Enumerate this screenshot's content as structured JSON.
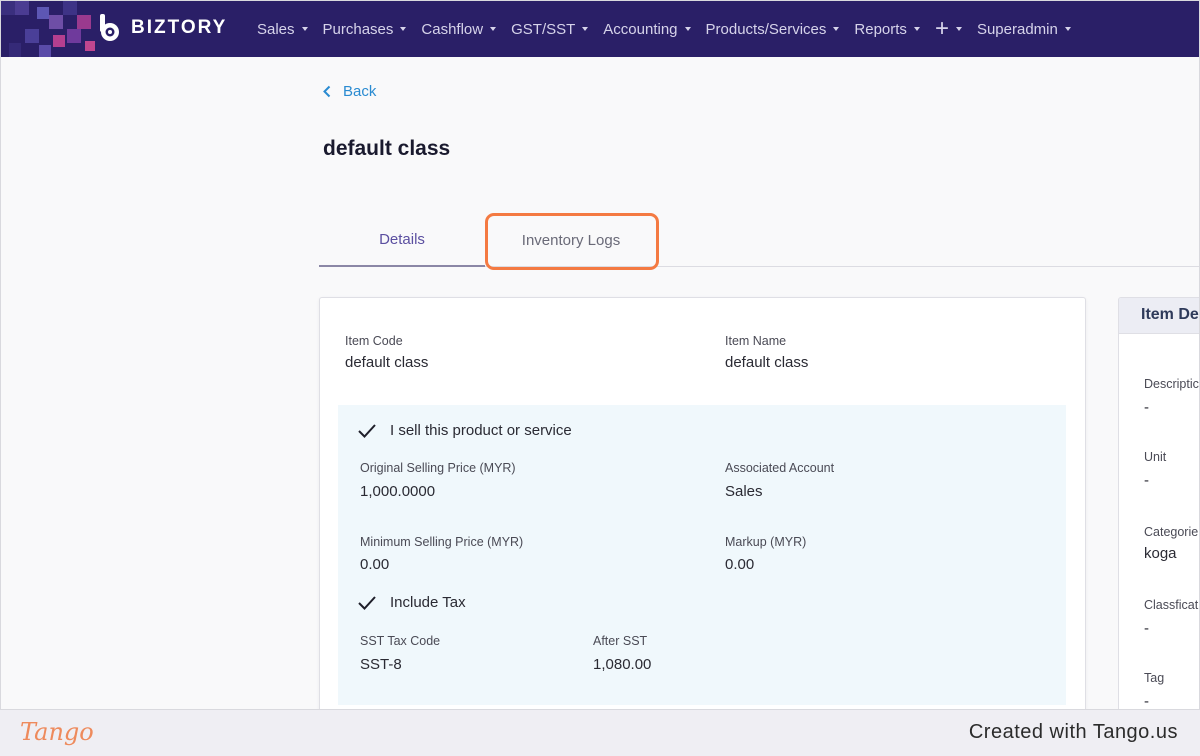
{
  "brand": {
    "name": "BIZTORY",
    "nav_bg": "#2a1f67"
  },
  "nav": {
    "items": [
      {
        "label": "Sales",
        "name": "nav-sales"
      },
      {
        "label": "Purchases",
        "name": "nav-purchases"
      },
      {
        "label": "Cashflow",
        "name": "nav-cashflow"
      },
      {
        "label": "GST/SST",
        "name": "nav-gst-sst"
      },
      {
        "label": "Accounting",
        "name": "nav-accounting"
      },
      {
        "label": "Products/Services",
        "name": "nav-products-services"
      },
      {
        "label": "Reports",
        "name": "nav-reports"
      }
    ],
    "plus_icon": "+",
    "user_label": "Superadmin"
  },
  "back": {
    "label": "Back"
  },
  "page": {
    "title": "default class"
  },
  "tabs": [
    {
      "label": "Details",
      "active": true
    },
    {
      "label": "Inventory Logs",
      "active": false
    }
  ],
  "details": {
    "item_code_label": "Item Code",
    "item_code": "default class",
    "item_name_label": "Item Name",
    "item_name": "default class",
    "sell_label": "I sell this product or service",
    "original_price_label": "Original Selling Price (MYR)",
    "original_price": "1,000.0000",
    "associated_account_label": "Associated Account",
    "associated_account": "Sales",
    "minimum_price_label": "Minimum Selling Price (MYR)",
    "minimum_price": "0.00",
    "markup_label": "Markup (MYR)",
    "markup": "0.00",
    "include_tax_label": "Include Tax",
    "sst_tax_code_label": "SST Tax Code",
    "sst_tax_code": "SST-8",
    "after_sst_label": "After SST",
    "after_sst": "1,080.00"
  },
  "side": {
    "title": "Item De",
    "fields": [
      {
        "label": "Descriptic",
        "value": "-"
      },
      {
        "label": "Unit",
        "value": "-"
      },
      {
        "label": "Categorie",
        "value": "koga"
      },
      {
        "label": "Classficat",
        "value": "-"
      },
      {
        "label": "Tag",
        "value": "-"
      }
    ]
  },
  "footer": {
    "logo": "Tango",
    "created": "Created with Tango.us"
  },
  "colors": {
    "accent_link": "#2a8bd1",
    "highlight": "#f47a42",
    "sell_bg": "#f0f8fc"
  }
}
